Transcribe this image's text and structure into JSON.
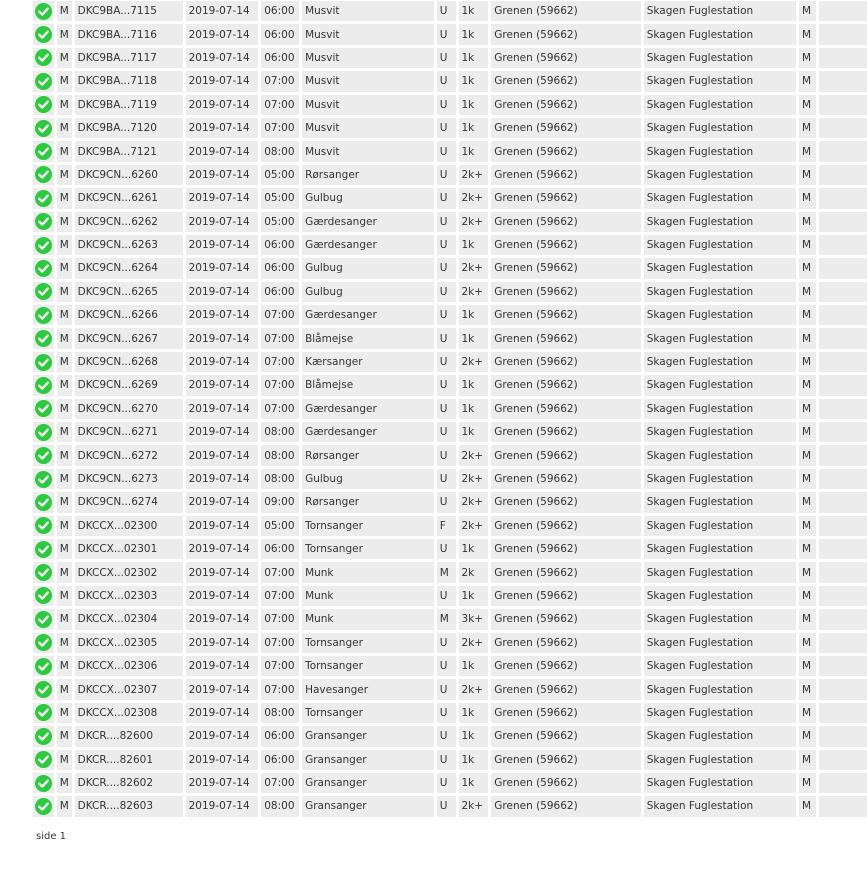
{
  "colors": {
    "ok_icon": "#2dc93e",
    "row_bg": "#ececec"
  },
  "icons": {
    "row_status": "check-circle-icon"
  },
  "rows": [
    {
      "type": "M",
      "ring": "DKC9BA...7115",
      "date": "2019-07-14",
      "time": "06:00",
      "species": "Musvit",
      "sex": "U",
      "age": "1k",
      "place": "Grenen (59662)",
      "station": "Skagen Fuglestation",
      "flag": "M"
    },
    {
      "type": "M",
      "ring": "DKC9BA...7116",
      "date": "2019-07-14",
      "time": "06:00",
      "species": "Musvit",
      "sex": "U",
      "age": "1k",
      "place": "Grenen (59662)",
      "station": "Skagen Fuglestation",
      "flag": "M"
    },
    {
      "type": "M",
      "ring": "DKC9BA...7117",
      "date": "2019-07-14",
      "time": "06:00",
      "species": "Musvit",
      "sex": "U",
      "age": "1k",
      "place": "Grenen (59662)",
      "station": "Skagen Fuglestation",
      "flag": "M"
    },
    {
      "type": "M",
      "ring": "DKC9BA...7118",
      "date": "2019-07-14",
      "time": "07:00",
      "species": "Musvit",
      "sex": "U",
      "age": "1k",
      "place": "Grenen (59662)",
      "station": "Skagen Fuglestation",
      "flag": "M"
    },
    {
      "type": "M",
      "ring": "DKC9BA...7119",
      "date": "2019-07-14",
      "time": "07:00",
      "species": "Musvit",
      "sex": "U",
      "age": "1k",
      "place": "Grenen (59662)",
      "station": "Skagen Fuglestation",
      "flag": "M"
    },
    {
      "type": "M",
      "ring": "DKC9BA...7120",
      "date": "2019-07-14",
      "time": "07:00",
      "species": "Musvit",
      "sex": "U",
      "age": "1k",
      "place": "Grenen (59662)",
      "station": "Skagen Fuglestation",
      "flag": "M"
    },
    {
      "type": "M",
      "ring": "DKC9BA...7121",
      "date": "2019-07-14",
      "time": "08:00",
      "species": "Musvit",
      "sex": "U",
      "age": "1k",
      "place": "Grenen (59662)",
      "station": "Skagen Fuglestation",
      "flag": "M"
    },
    {
      "type": "M",
      "ring": "DKC9CN...6260",
      "date": "2019-07-14",
      "time": "05:00",
      "species": "Rørsanger",
      "sex": "U",
      "age": "2k+",
      "place": "Grenen (59662)",
      "station": "Skagen Fuglestation",
      "flag": "M"
    },
    {
      "type": "M",
      "ring": "DKC9CN...6261",
      "date": "2019-07-14",
      "time": "05:00",
      "species": "Gulbug",
      "sex": "U",
      "age": "2k+",
      "place": "Grenen (59662)",
      "station": "Skagen Fuglestation",
      "flag": "M"
    },
    {
      "type": "M",
      "ring": "DKC9CN...6262",
      "date": "2019-07-14",
      "time": "05:00",
      "species": "Gærdesanger",
      "sex": "U",
      "age": "2k+",
      "place": "Grenen (59662)",
      "station": "Skagen Fuglestation",
      "flag": "M"
    },
    {
      "type": "M",
      "ring": "DKC9CN...6263",
      "date": "2019-07-14",
      "time": "06:00",
      "species": "Gærdesanger",
      "sex": "U",
      "age": "1k",
      "place": "Grenen (59662)",
      "station": "Skagen Fuglestation",
      "flag": "M"
    },
    {
      "type": "M",
      "ring": "DKC9CN...6264",
      "date": "2019-07-14",
      "time": "06:00",
      "species": "Gulbug",
      "sex": "U",
      "age": "2k+",
      "place": "Grenen (59662)",
      "station": "Skagen Fuglestation",
      "flag": "M"
    },
    {
      "type": "M",
      "ring": "DKC9CN...6265",
      "date": "2019-07-14",
      "time": "06:00",
      "species": "Gulbug",
      "sex": "U",
      "age": "2k+",
      "place": "Grenen (59662)",
      "station": "Skagen Fuglestation",
      "flag": "M"
    },
    {
      "type": "M",
      "ring": "DKC9CN...6266",
      "date": "2019-07-14",
      "time": "07:00",
      "species": "Gærdesanger",
      "sex": "U",
      "age": "1k",
      "place": "Grenen (59662)",
      "station": "Skagen Fuglestation",
      "flag": "M"
    },
    {
      "type": "M",
      "ring": "DKC9CN...6267",
      "date": "2019-07-14",
      "time": "07:00",
      "species": "Blåmejse",
      "sex": "U",
      "age": "1k",
      "place": "Grenen (59662)",
      "station": "Skagen Fuglestation",
      "flag": "M"
    },
    {
      "type": "M",
      "ring": "DKC9CN...6268",
      "date": "2019-07-14",
      "time": "07:00",
      "species": "Kærsanger",
      "sex": "U",
      "age": "2k+",
      "place": "Grenen (59662)",
      "station": "Skagen Fuglestation",
      "flag": "M"
    },
    {
      "type": "M",
      "ring": "DKC9CN...6269",
      "date": "2019-07-14",
      "time": "07:00",
      "species": "Blåmejse",
      "sex": "U",
      "age": "1k",
      "place": "Grenen (59662)",
      "station": "Skagen Fuglestation",
      "flag": "M"
    },
    {
      "type": "M",
      "ring": "DKC9CN...6270",
      "date": "2019-07-14",
      "time": "07:00",
      "species": "Gærdesanger",
      "sex": "U",
      "age": "1k",
      "place": "Grenen (59662)",
      "station": "Skagen Fuglestation",
      "flag": "M"
    },
    {
      "type": "M",
      "ring": "DKC9CN...6271",
      "date": "2019-07-14",
      "time": "08:00",
      "species": "Gærdesanger",
      "sex": "U",
      "age": "1k",
      "place": "Grenen (59662)",
      "station": "Skagen Fuglestation",
      "flag": "M"
    },
    {
      "type": "M",
      "ring": "DKC9CN...6272",
      "date": "2019-07-14",
      "time": "08:00",
      "species": "Rørsanger",
      "sex": "U",
      "age": "2k+",
      "place": "Grenen (59662)",
      "station": "Skagen Fuglestation",
      "flag": "M"
    },
    {
      "type": "M",
      "ring": "DKC9CN...6273",
      "date": "2019-07-14",
      "time": "08:00",
      "species": "Gulbug",
      "sex": "U",
      "age": "2k+",
      "place": "Grenen (59662)",
      "station": "Skagen Fuglestation",
      "flag": "M"
    },
    {
      "type": "M",
      "ring": "DKC9CN...6274",
      "date": "2019-07-14",
      "time": "09:00",
      "species": "Rørsanger",
      "sex": "U",
      "age": "2k+",
      "place": "Grenen (59662)",
      "station": "Skagen Fuglestation",
      "flag": "M"
    },
    {
      "type": "M",
      "ring": "DKCCX...02300",
      "date": "2019-07-14",
      "time": "05:00",
      "species": "Tornsanger",
      "sex": "F",
      "age": "2k+",
      "place": "Grenen (59662)",
      "station": "Skagen Fuglestation",
      "flag": "M"
    },
    {
      "type": "M",
      "ring": "DKCCX...02301",
      "date": "2019-07-14",
      "time": "06:00",
      "species": "Tornsanger",
      "sex": "U",
      "age": "1k",
      "place": "Grenen (59662)",
      "station": "Skagen Fuglestation",
      "flag": "M"
    },
    {
      "type": "M",
      "ring": "DKCCX...02302",
      "date": "2019-07-14",
      "time": "07:00",
      "species": "Munk",
      "sex": "M",
      "age": "2k",
      "place": "Grenen (59662)",
      "station": "Skagen Fuglestation",
      "flag": "M"
    },
    {
      "type": "M",
      "ring": "DKCCX...02303",
      "date": "2019-07-14",
      "time": "07:00",
      "species": "Munk",
      "sex": "U",
      "age": "1k",
      "place": "Grenen (59662)",
      "station": "Skagen Fuglestation",
      "flag": "M"
    },
    {
      "type": "M",
      "ring": "DKCCX...02304",
      "date": "2019-07-14",
      "time": "07:00",
      "species": "Munk",
      "sex": "M",
      "age": "3k+",
      "place": "Grenen (59662)",
      "station": "Skagen Fuglestation",
      "flag": "M"
    },
    {
      "type": "M",
      "ring": "DKCCX...02305",
      "date": "2019-07-14",
      "time": "07:00",
      "species": "Tornsanger",
      "sex": "U",
      "age": "2k+",
      "place": "Grenen (59662)",
      "station": "Skagen Fuglestation",
      "flag": "M"
    },
    {
      "type": "M",
      "ring": "DKCCX...02306",
      "date": "2019-07-14",
      "time": "07:00",
      "species": "Tornsanger",
      "sex": "U",
      "age": "1k",
      "place": "Grenen (59662)",
      "station": "Skagen Fuglestation",
      "flag": "M"
    },
    {
      "type": "M",
      "ring": "DKCCX...02307",
      "date": "2019-07-14",
      "time": "07:00",
      "species": "Havesanger",
      "sex": "U",
      "age": "2k+",
      "place": "Grenen (59662)",
      "station": "Skagen Fuglestation",
      "flag": "M"
    },
    {
      "type": "M",
      "ring": "DKCCX...02308",
      "date": "2019-07-14",
      "time": "08:00",
      "species": "Tornsanger",
      "sex": "U",
      "age": "1k",
      "place": "Grenen (59662)",
      "station": "Skagen Fuglestation",
      "flag": "M"
    },
    {
      "type": "M",
      "ring": "DKCR....82600",
      "date": "2019-07-14",
      "time": "06:00",
      "species": "Gransanger",
      "sex": "U",
      "age": "1k",
      "place": "Grenen (59662)",
      "station": "Skagen Fuglestation",
      "flag": "M"
    },
    {
      "type": "M",
      "ring": "DKCR....82601",
      "date": "2019-07-14",
      "time": "06:00",
      "species": "Gransanger",
      "sex": "U",
      "age": "1k",
      "place": "Grenen (59662)",
      "station": "Skagen Fuglestation",
      "flag": "M"
    },
    {
      "type": "M",
      "ring": "DKCR....82602",
      "date": "2019-07-14",
      "time": "07:00",
      "species": "Gransanger",
      "sex": "U",
      "age": "1k",
      "place": "Grenen (59662)",
      "station": "Skagen Fuglestation",
      "flag": "M"
    },
    {
      "type": "M",
      "ring": "DKCR....82603",
      "date": "2019-07-14",
      "time": "08:00",
      "species": "Gransanger",
      "sex": "U",
      "age": "2k+",
      "place": "Grenen (59662)",
      "station": "Skagen Fuglestation",
      "flag": "M"
    }
  ],
  "pager": {
    "label": "side 1"
  }
}
